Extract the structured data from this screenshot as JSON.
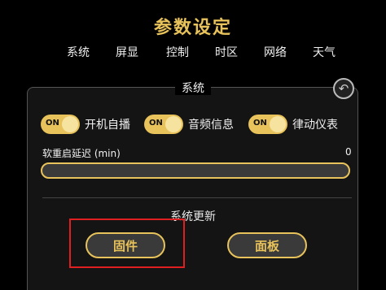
{
  "title": "参数设定",
  "tabs": [
    "系统",
    "屏显",
    "控制",
    "时区",
    "网络",
    "天气"
  ],
  "section": {
    "legend": "系统",
    "back_icon": "undo-icon",
    "toggles": [
      {
        "state": "ON",
        "label": "开机自播",
        "on": true
      },
      {
        "state": "ON",
        "label": "音频信息",
        "on": true
      },
      {
        "state": "ON",
        "label": "律动仪表",
        "on": true
      }
    ],
    "slider": {
      "label": "软重启延迟 (min)",
      "value": "0"
    },
    "update": {
      "title": "系统更新",
      "firmware_button": "固件",
      "panel_button": "面板"
    }
  },
  "colors": {
    "accent": "#e8c25a",
    "background": "#000000",
    "highlight": "#e02020"
  }
}
